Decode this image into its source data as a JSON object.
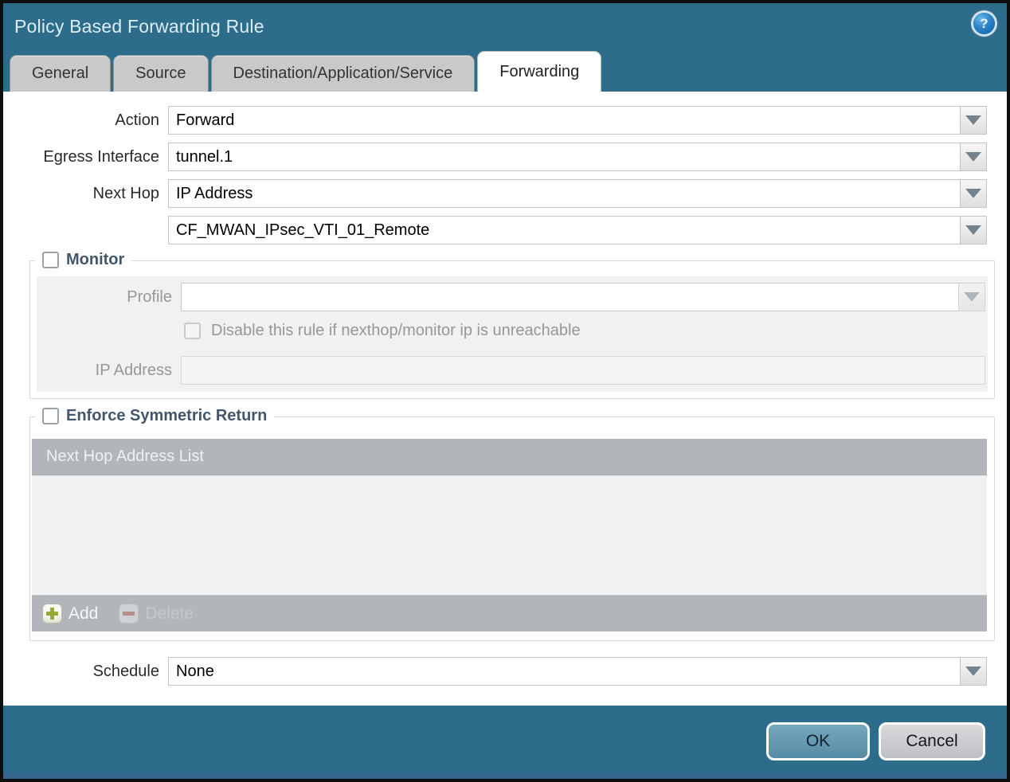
{
  "window": {
    "title": "Policy Based Forwarding Rule",
    "help_glyph": "?"
  },
  "tabs": [
    {
      "label": "General",
      "active": false
    },
    {
      "label": "Source",
      "active": false
    },
    {
      "label": "Destination/Application/Service",
      "active": false
    },
    {
      "label": "Forwarding",
      "active": true
    }
  ],
  "form": {
    "action": {
      "label": "Action",
      "value": "Forward"
    },
    "egress_interface": {
      "label": "Egress Interface",
      "value": "tunnel.1"
    },
    "next_hop": {
      "label": "Next Hop",
      "value": "IP Address"
    },
    "next_hop_address": {
      "value": "CF_MWAN_IPsec_VTI_01_Remote"
    },
    "schedule": {
      "label": "Schedule",
      "value": "None"
    }
  },
  "monitor": {
    "title": "Monitor",
    "checked": false,
    "profile": {
      "label": "Profile",
      "value": ""
    },
    "disable_rule": {
      "label": "Disable this rule if nexthop/monitor ip is unreachable",
      "checked": false
    },
    "ip_address": {
      "label": "IP Address",
      "value": ""
    }
  },
  "symmetric_return": {
    "title": "Enforce Symmetric Return",
    "checked": false,
    "table": {
      "header": "Next Hop Address List",
      "rows": []
    },
    "toolbar": {
      "add_label": "Add",
      "delete_label": "Delete",
      "delete_enabled": false
    }
  },
  "footer": {
    "ok_label": "OK",
    "cancel_label": "Cancel"
  },
  "colors": {
    "titlebar": "#2d6c8b",
    "active_tab": "#ffffff",
    "inactive_tab": "#c9c9c9",
    "group_title": "#44566b",
    "table_chrome": "#b2b6ba",
    "add_icon_green": "#94aa38",
    "delete_icon_red": "#bc8076",
    "ok_button": "#5e93ac",
    "cancel_button": "#c9cacd",
    "disabled_beige_field": "#f4eedb"
  }
}
